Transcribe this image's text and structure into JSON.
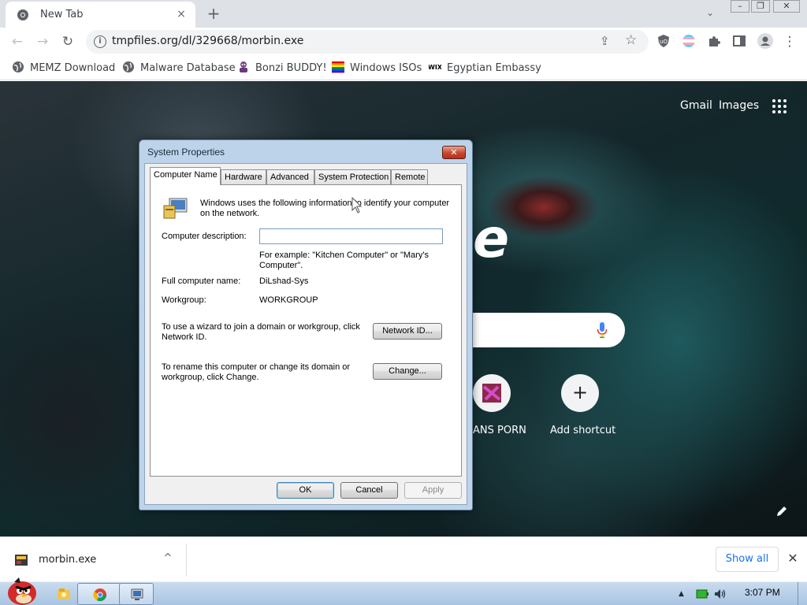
{
  "browser": {
    "tab": {
      "title": "New Tab",
      "close_icon": "×"
    },
    "new_tab_icon": "+",
    "tab_search_icon": "⌄",
    "window_controls": {
      "minimize": "–",
      "maximize": "❐",
      "close": "✕"
    },
    "nav": {
      "back": "←",
      "forward": "→",
      "reload": "↻"
    },
    "address": {
      "info_icon": "i",
      "url": "tmpfiles.org/dl/329668/morbin.exe",
      "share_icon": "⇪",
      "star_icon": "☆"
    },
    "menu_icon": "⋮",
    "bookmarks": [
      {
        "label": "MEMZ Download",
        "icon": "globe-icon"
      },
      {
        "label": "Malware Database",
        "icon": "globe-icon"
      },
      {
        "label": "Bonzi BUDDY!",
        "icon": "bonzi-icon"
      },
      {
        "label": "Windows ISOs",
        "icon": "rainbow-flag-icon"
      },
      {
        "label": "Egyptian Embassy",
        "icon": "wix-icon"
      }
    ]
  },
  "new_tab_page": {
    "gmail": "Gmail",
    "images": "Images",
    "logo_fragment": "e",
    "shortcuts": [
      {
        "label": "ANS PORN"
      },
      {
        "label": "Add shortcut",
        "icon": "+"
      }
    ]
  },
  "dialog": {
    "title": "System Properties",
    "close_icon": "✕",
    "tabs": [
      "Computer Name",
      "Hardware",
      "Advanced",
      "System Protection",
      "Remote"
    ],
    "intro": "Windows uses the following information to identify your computer on the network.",
    "description_label": "Computer description:",
    "description_value": "",
    "example": "For example: \"Kitchen Computer\" or \"Mary's Computer\".",
    "full_name_label": "Full computer name:",
    "full_name_value": "DiLshad-Sys",
    "workgroup_label": "Workgroup:",
    "workgroup_value": "WORKGROUP",
    "network_text": "To use a wizard to join a domain or workgroup, click Network ID.",
    "network_button": "Network ID...",
    "rename_text": "To rename this computer or change its domain or workgroup, click Change.",
    "change_button": "Change...",
    "ok": "OK",
    "cancel": "Cancel",
    "apply": "Apply"
  },
  "download_bar": {
    "file": "morbin.exe",
    "chevron": "^",
    "show_all": "Show all",
    "close_icon": "✕"
  },
  "taskbar": {
    "tray_arrow": "▲",
    "clock": "3:07 PM"
  },
  "colors": {
    "accent": "#1a73e8",
    "dialog_frame": "#bcd3ea",
    "close_red": "#c8452f"
  }
}
